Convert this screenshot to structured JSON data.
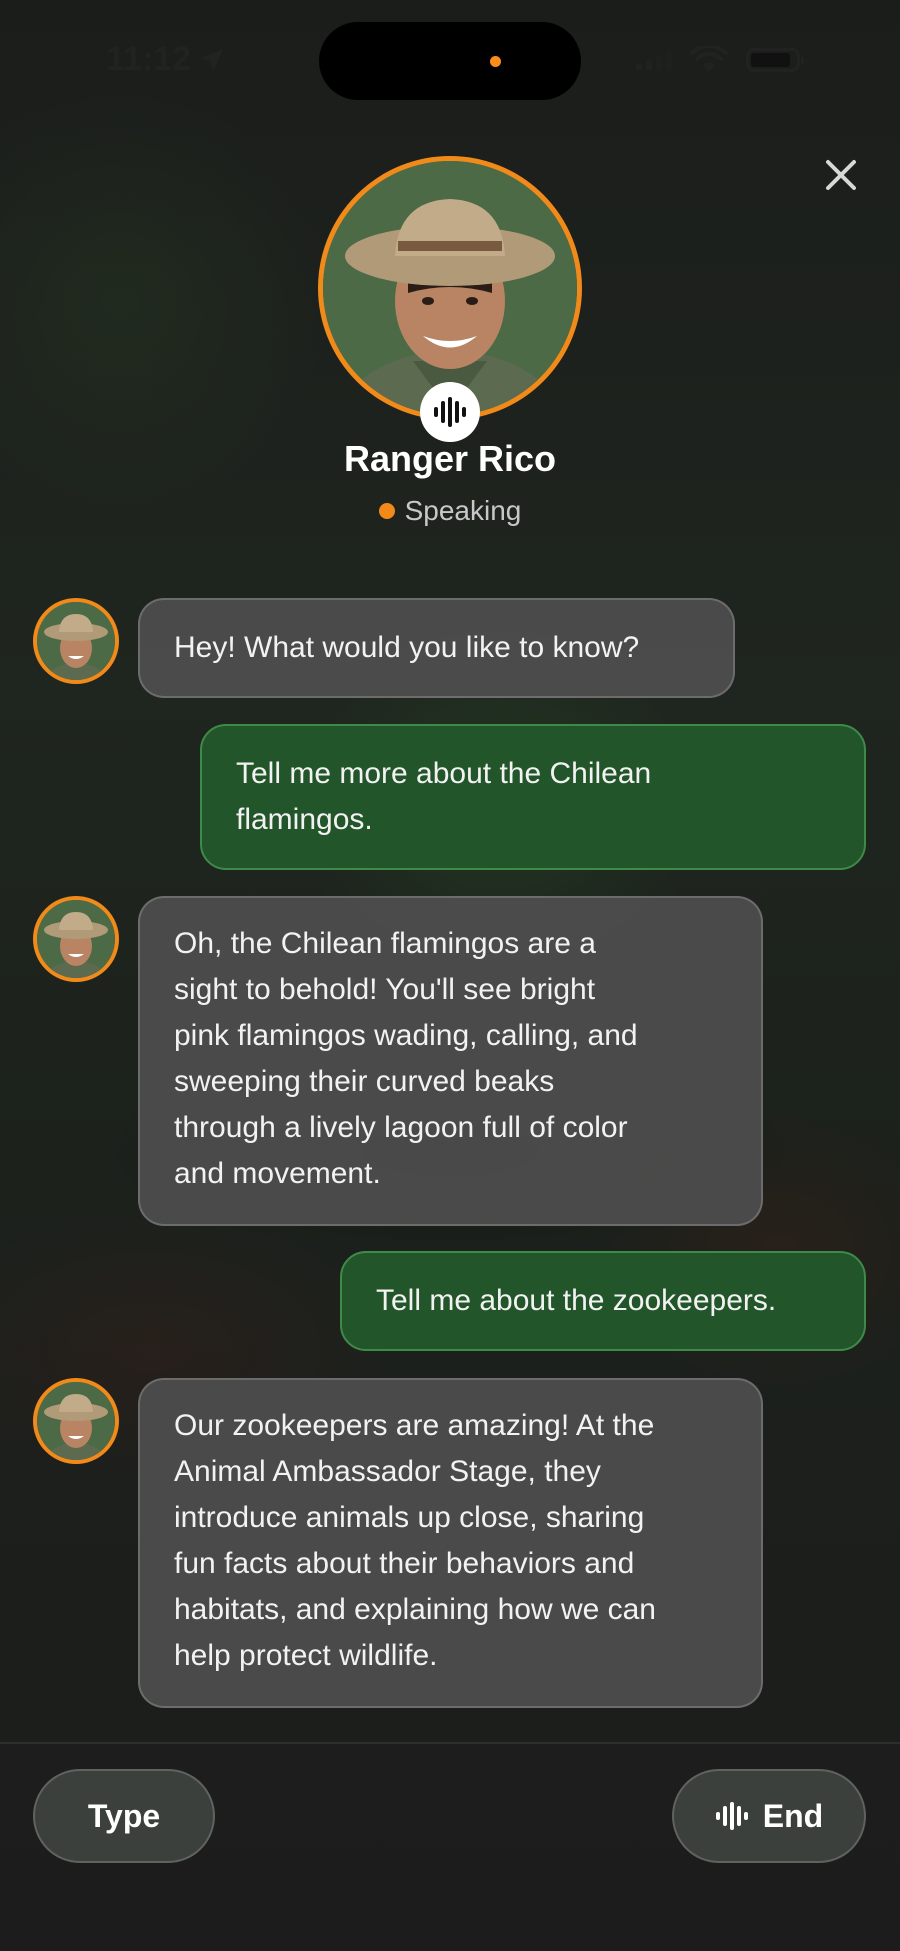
{
  "status_bar": {
    "time": "11:12",
    "icons": [
      "location-arrow-icon",
      "cellular-signal-icon",
      "wifi-icon",
      "battery-icon"
    ]
  },
  "header": {
    "close_icon": "close-icon",
    "name": "Ranger Rico",
    "status": "Speaking",
    "voice_icon": "voice-waveform-icon"
  },
  "messages": [
    {
      "from": "bot",
      "text": "Hey! What would you like to know?"
    },
    {
      "from": "user",
      "lines": [
        "Tell me more about the Chilean",
        "flamingos."
      ]
    },
    {
      "from": "bot",
      "lines": [
        "Oh, the Chilean flamingos are a",
        "sight to behold! You'll see bright",
        "pink flamingos wading, calling, and",
        "sweeping their curved beaks",
        "through a lively lagoon full of color",
        "and movement."
      ]
    },
    {
      "from": "user",
      "text": "Tell me about the zookeepers."
    },
    {
      "from": "bot",
      "lines": [
        "Our zookeepers are amazing! At the",
        "Animal Ambassador Stage, they",
        "introduce animals up close, sharing",
        "fun facts about their behaviors and",
        "habitats, and explaining how we can",
        "help protect wildlife."
      ]
    }
  ],
  "footer": {
    "type_label": "Type",
    "end_label": "End",
    "end_icon": "voice-waveform-icon"
  },
  "colors": {
    "accent": "#f28a1a",
    "user_bubble": "#23552a",
    "bot_bubble": "#4e4e4e"
  }
}
